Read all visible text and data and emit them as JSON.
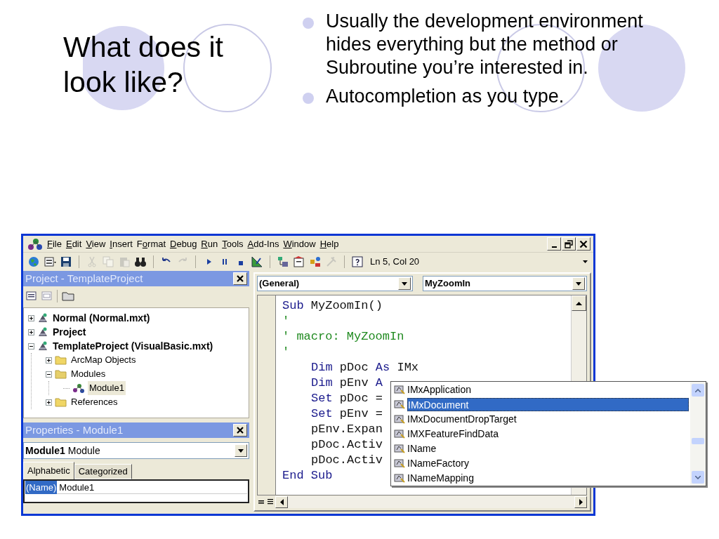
{
  "slide": {
    "title": "What does it look like?",
    "bullets": [
      "Usually the development environment hides everything but the method or Subroutine you’re interested in.",
      "Autocompletion as you type."
    ]
  },
  "menu": [
    {
      "key": "F",
      "after": "ile"
    },
    {
      "key": "E",
      "after": "dit"
    },
    {
      "key": "V",
      "after": "iew"
    },
    {
      "key": "I",
      "after": "nsert"
    },
    {
      "before": "F",
      "key": "o",
      "after": "rmat"
    },
    {
      "key": "D",
      "after": "ebug"
    },
    {
      "key": "R",
      "after": "un"
    },
    {
      "key": "T",
      "after": "ools"
    },
    {
      "key": "A",
      "after": "dd-Ins"
    },
    {
      "key": "W",
      "after": "indow"
    },
    {
      "key": "H",
      "after": "elp"
    }
  ],
  "toolbar": {
    "buttons": [
      {
        "kind": "host",
        "disabled": false
      },
      {
        "kind": "insert",
        "disabled": false
      },
      {
        "kind": "save",
        "disabled": false
      },
      {
        "kind": "sep",
        "disabled": false
      },
      {
        "kind": "cut",
        "disabled": true
      },
      {
        "kind": "copy",
        "disabled": true
      },
      {
        "kind": "paste",
        "disabled": true
      },
      {
        "kind": "find",
        "disabled": false
      },
      {
        "kind": "sep",
        "disabled": false
      },
      {
        "kind": "undo",
        "disabled": false
      },
      {
        "kind": "redo",
        "disabled": true
      },
      {
        "kind": "sep",
        "disabled": false
      },
      {
        "kind": "run",
        "disabled": false
      },
      {
        "kind": "pause",
        "disabled": false
      },
      {
        "kind": "stop",
        "disabled": false
      },
      {
        "kind": "design",
        "disabled": false
      },
      {
        "kind": "sep",
        "disabled": false
      },
      {
        "kind": "project",
        "disabled": false
      },
      {
        "kind": "properties",
        "disabled": false
      },
      {
        "kind": "browser",
        "disabled": false
      },
      {
        "kind": "toolbox",
        "disabled": true
      },
      {
        "kind": "sep",
        "disabled": false
      },
      {
        "kind": "help",
        "disabled": false
      }
    ],
    "position": "Ln 5, Col 20"
  },
  "project_pane": {
    "title": "Project - TemplateProject",
    "tree": [
      {
        "kind": "project",
        "label": "Normal (Normal.mxt)",
        "expanded": false,
        "selected": false
      },
      {
        "kind": "project",
        "label": "Project",
        "expanded": false,
        "selected": false
      },
      {
        "kind": "project",
        "label": "TemplateProject (VisualBasic.mxt)",
        "expanded": true,
        "selected": false,
        "children": [
          {
            "kind": "folder",
            "label": "ArcMap Objects",
            "expanded": false,
            "selected": false
          },
          {
            "kind": "folder",
            "label": "Modules",
            "expanded": true,
            "selected": false,
            "children": [
              {
                "kind": "module",
                "label": "Module1",
                "selected": true
              }
            ]
          },
          {
            "kind": "folder",
            "label": "References",
            "expanded": false,
            "selected": false
          }
        ]
      }
    ]
  },
  "properties_pane": {
    "title": "Properties - Module1",
    "object": {
      "name": "Module1",
      "type": "Module"
    },
    "tabs": [
      {
        "label": "Alphabetic",
        "selected": true
      },
      {
        "label": "Categorized",
        "selected": false
      }
    ],
    "rows": [
      {
        "name": "(Name)",
        "value": "Module1",
        "selected": true
      }
    ]
  },
  "code_window": {
    "object_combo": "(General)",
    "procedure_combo": "MyZoomIn",
    "lines": [
      {
        "indented": false,
        "tokens": [
          {
            "kind": "keyword",
            "text": "Sub"
          },
          {
            "kind": "plain",
            "text": " MyZoomIn()"
          }
        ]
      },
      {
        "indented": false,
        "tokens": [
          {
            "kind": "comment",
            "text": "'"
          }
        ]
      },
      {
        "indented": false,
        "tokens": [
          {
            "kind": "comment",
            "text": "' macro: MyZoomIn"
          }
        ]
      },
      {
        "indented": false,
        "tokens": [
          {
            "kind": "comment",
            "text": "'"
          }
        ]
      },
      {
        "indented": true,
        "tokens": [
          {
            "kind": "keyword",
            "text": "Dim"
          },
          {
            "kind": "plain",
            "text": " pDoc "
          },
          {
            "kind": "keyword",
            "text": "As"
          },
          {
            "kind": "plain",
            "text": " IMx"
          }
        ]
      },
      {
        "indented": true,
        "tokens": [
          {
            "kind": "keyword",
            "text": "Dim"
          },
          {
            "kind": "plain",
            "text": " pEnv "
          },
          {
            "kind": "keyword",
            "text": "A"
          }
        ]
      },
      {
        "indented": true,
        "tokens": [
          {
            "kind": "keyword",
            "text": "Set"
          },
          {
            "kind": "plain",
            "text": " pDoc ="
          }
        ]
      },
      {
        "indented": true,
        "tokens": [
          {
            "kind": "keyword",
            "text": "Set"
          },
          {
            "kind": "plain",
            "text": " pEnv ="
          }
        ]
      },
      {
        "indented": true,
        "tokens": [
          {
            "kind": "plain",
            "text": "pEnv.Expan"
          }
        ]
      },
      {
        "indented": true,
        "tokens": [
          {
            "kind": "plain",
            "text": "pDoc.Activ"
          }
        ]
      },
      {
        "indented": true,
        "tokens": [
          {
            "kind": "plain",
            "text": "pDoc.Activ"
          }
        ]
      },
      {
        "indented": false,
        "tokens": [
          {
            "kind": "keyword",
            "text": "End Sub"
          }
        ]
      }
    ],
    "autocomplete": [
      {
        "label": "IMxApplication",
        "selected": false
      },
      {
        "label": "IMxDocument",
        "selected": true
      },
      {
        "label": "IMxDocumentDropTarget",
        "selected": false
      },
      {
        "label": "IMXFeatureFindData",
        "selected": false
      },
      {
        "label": "IName",
        "selected": false
      },
      {
        "label": "INameFactory",
        "selected": false
      },
      {
        "label": "INameMapping",
        "selected": false
      }
    ]
  }
}
